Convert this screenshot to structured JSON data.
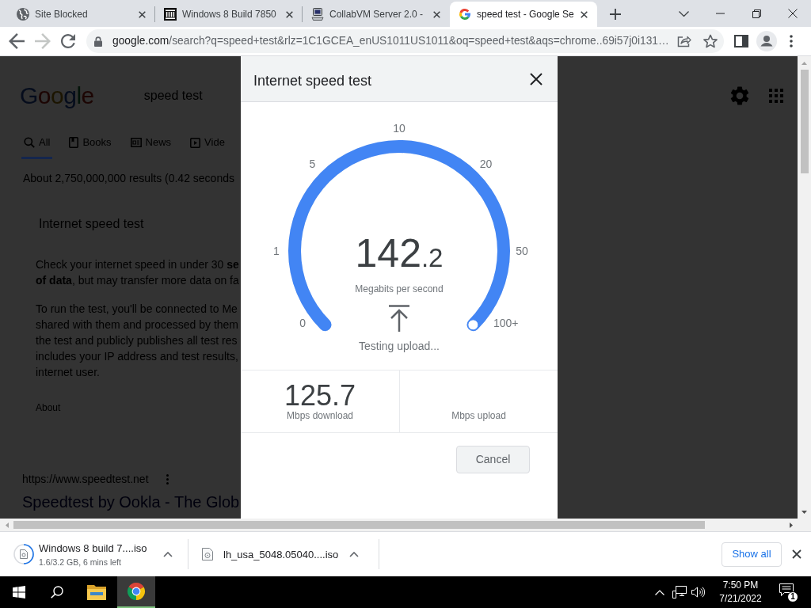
{
  "browser": {
    "tabs": [
      {
        "title": "Site Blocked",
        "kind": "globe",
        "selected": false
      },
      {
        "title": "Windows 8 Build 7850",
        "kind": "pillars",
        "selected": false
      },
      {
        "title": "CollabVM Server 2.0 -",
        "kind": "computer",
        "selected": false
      },
      {
        "title": "speed test - Google Se",
        "kind": "g",
        "selected": true
      }
    ],
    "forward": {
      "disabled": true
    },
    "address": {
      "host": "google.com",
      "path": "/search?q=speed+test&rlz=1C1GCEA_enUS1011US1011&oq=speed+test&aqs=chrome..69i57j0i131…"
    }
  },
  "page": {
    "logo": "Google",
    "query": "speed test",
    "tabs": [
      {
        "label": "All",
        "kind": "search",
        "selected": true
      },
      {
        "label": "Books",
        "kind": "book",
        "selected": false
      },
      {
        "label": "News",
        "kind": "news",
        "selected": false
      },
      {
        "label": "Vide",
        "kind": "video",
        "selected": false
      }
    ],
    "result_stats": "About 2,750,000,000 results (0.42 seconds",
    "card_title": "Internet speed test",
    "paragraphs": [
      "Check your internet speed in under 30 **se**\n**of data**, but may transfer more data on fa",
      "To run the test, you'll be connected to Me\nshared with them and processed by them\nthe test and publicly publishes all test res\nincludes your IP address and test results,\ninternet user."
    ],
    "about": "About",
    "result": {
      "url": "https://www.speedtest.net",
      "title": "Speedtest by Ookla - The Glob"
    }
  },
  "dialog": {
    "title": "Internet speed test",
    "gauge": {
      "level": 1,
      "scale": [
        "0",
        "1",
        "5",
        "10",
        "20",
        "50",
        "100+"
      ],
      "value": "142",
      "fraction": ".2",
      "unit": "Megabits per second",
      "status": "Testing upload..."
    },
    "results": [
      {
        "value": "125.7",
        "label": "Mbps download"
      },
      {
        "label": "Mbps upload"
      }
    ],
    "cancel": "Cancel"
  },
  "downloads": {
    "items": [
      {
        "name": "Windows 8 build 7....iso",
        "detail": "1.6/3.2 GB, 6 mins left",
        "level": 0.5
      },
      {
        "name": "lh_usa_5048.05040....iso"
      }
    ],
    "show_all": "Show all"
  },
  "taskbar": {
    "apps": [
      {
        "kind": "folder",
        "selected": false
      },
      {
        "kind": "browser",
        "selected": true
      }
    ],
    "time": "7:50 PM",
    "date": "7/21/2022",
    "notifications": "1"
  }
}
